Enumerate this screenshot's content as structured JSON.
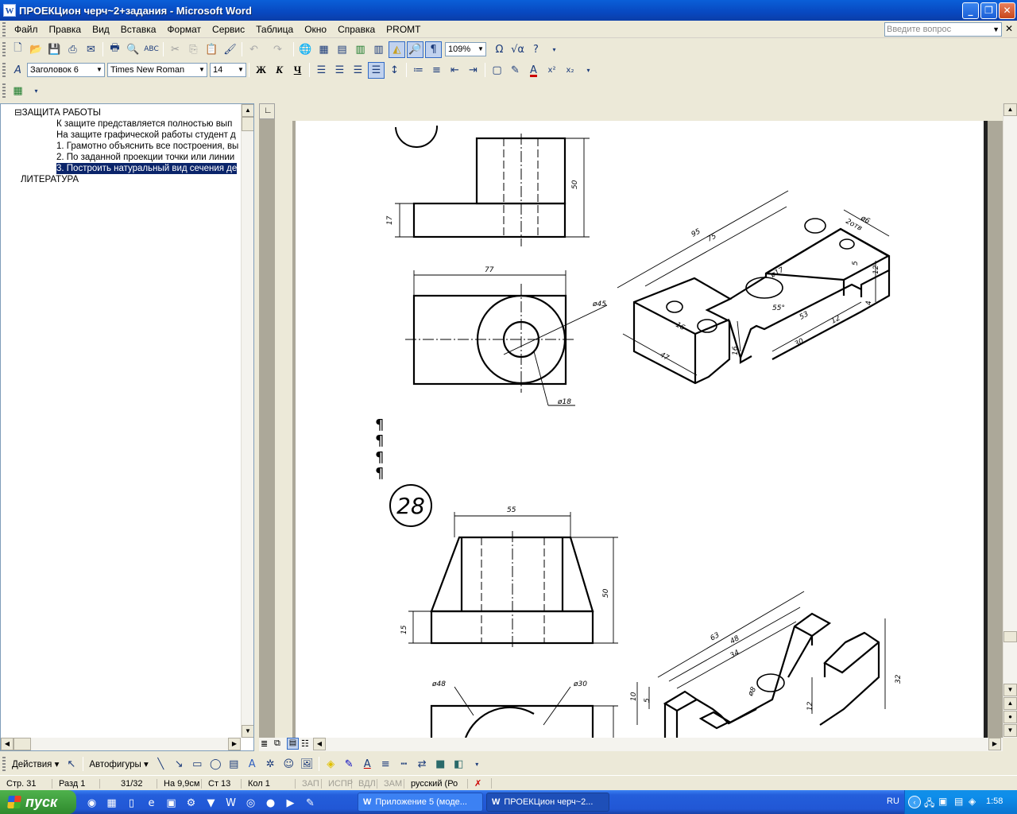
{
  "window": {
    "title": "ПРОЕКЦион черч~2+задания - Microsoft Word",
    "app_icon_letter": "W",
    "minimize": "_",
    "restore": "❐",
    "close": "✕"
  },
  "menu": {
    "items": [
      "Файл",
      "Правка",
      "Вид",
      "Вставка",
      "Формат",
      "Сервис",
      "Таблица",
      "Окно",
      "Справка",
      "PROMT"
    ],
    "help_placeholder": "Введите вопрос",
    "close_doc": "✕"
  },
  "toolbar_standard": {
    "zoom": "109%"
  },
  "toolbar_format": {
    "style": "Заголовок 6",
    "font": "Times New Roman",
    "size": "14",
    "bold": "Ж",
    "italic": "К",
    "underline": "Ч"
  },
  "docmap": {
    "items": [
      {
        "text": "⊟ЗАЩИТА РАБОТЫ"
      },
      {
        "text": "К защите представляется полностью вып"
      },
      {
        "text": "На защите графической работы студент д"
      },
      {
        "text": "1. Грамотно объяснить все построения, вы"
      },
      {
        "text": "2. По заданной проекции точки или линии"
      },
      {
        "text": "3. Построить натуральный вид сечения де"
      },
      {
        "text": "ЛИТЕРАТУРА"
      }
    ]
  },
  "document": {
    "pilcrow": "¶",
    "drawing1": {
      "dims": {
        "d50": "50",
        "d17": "17",
        "d77": "77",
        "d45": "ø45",
        "d18": "ø18",
        "d95": "95",
        "d75": "75",
        "d6": "ø6",
        "d2otb": "2отв",
        "d17b": "ø17",
        "d55deg": "55°",
        "d53": "53",
        "d12a": "12",
        "d30": "30",
        "d16a": "16",
        "d47": "47",
        "d16b": "16",
        "d5": "5",
        "d12b": "12",
        "d4": "4"
      }
    },
    "drawing2": {
      "number": "28",
      "dims": {
        "d55": "55",
        "d50": "50",
        "d15": "15",
        "d48": "ø48",
        "d30": "ø30",
        "d63": "63",
        "d48b": "48",
        "d34": "34",
        "d32": "32",
        "d10": "10",
        "d5": "5",
        "d12": "12",
        "d8": "ø8"
      }
    }
  },
  "drawbar": {
    "actions": "Действия ▾",
    "autoshapes": "Автофигуры ▾"
  },
  "statusbar": {
    "page": "Стр. 31",
    "section": "Разд 1",
    "pages": "31/32",
    "at": "На 9,9см",
    "line": "Ст 13",
    "col": "Кол 1",
    "rec": "ЗАП",
    "trk": "ИСПР",
    "ext": "ВДЛ",
    "ovr": "ЗАМ",
    "lang": "русский (Ро"
  },
  "taskbar": {
    "start": "пуск",
    "tasks": [
      "Приложение 5 (моде...",
      "ПРОЕКЦион черч~2..."
    ],
    "lang": "RU",
    "time": "1:58"
  }
}
